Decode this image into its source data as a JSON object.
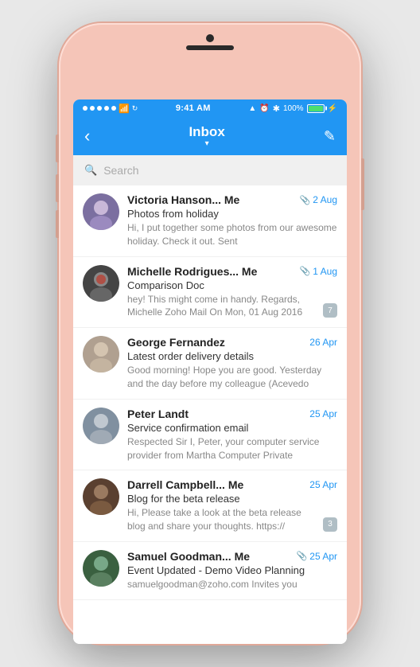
{
  "phone": {
    "status_bar": {
      "time": "9:41 AM",
      "battery_percent": "100%"
    },
    "header": {
      "back_label": "‹",
      "title": "Inbox",
      "chevron": "▾",
      "compose_label": "✎"
    },
    "search": {
      "placeholder": "Search"
    },
    "emails": [
      {
        "id": 1,
        "sender": "Victoria Hanson... Me",
        "date": "2 Aug",
        "has_attachment": true,
        "subject": "Photos from holiday",
        "preview": "Hi, I put together some photos from our awesome holiday. Check it out. Sent",
        "badge": null,
        "avatar_color": "#7B6FA0"
      },
      {
        "id": 2,
        "sender": "Michelle Rodrigues... Me",
        "date": "1 Aug",
        "has_attachment": true,
        "subject": "Comparison Doc",
        "preview": "hey! This might come in handy. Regards, Michelle Zoho Mail On Mon, 01 Aug 2016",
        "badge": "7",
        "avatar_color": "#c0392b"
      },
      {
        "id": 3,
        "sender": "George Fernandez",
        "date": "26 Apr",
        "has_attachment": false,
        "subject": "Latest order delivery details",
        "preview": "Good morning! Hope you are good. Yesterday and the day before my colleague (Acevedo",
        "badge": null,
        "avatar_color": "#95a5a6"
      },
      {
        "id": 4,
        "sender": "Peter Landt",
        "date": "25 Apr",
        "has_attachment": false,
        "subject": "Service confirmation email",
        "preview": "Respected Sir I, Peter, your computer service provider from Martha Computer Private",
        "badge": null,
        "avatar_color": "#e67e22"
      },
      {
        "id": 5,
        "sender": "Darrell Campbell... Me",
        "date": "25 Apr",
        "has_attachment": false,
        "subject": "Blog for the beta release",
        "preview": "Hi, Please take a look at the beta release blog and share your thoughts. https://",
        "badge": "3",
        "avatar_color": "#d35400"
      },
      {
        "id": 6,
        "sender": "Samuel Goodman... Me",
        "date": "25 Apr",
        "has_attachment": true,
        "subject": "Event Updated - Demo Video Planning",
        "preview": "samuelgoodman@zoho.com Invites you",
        "badge": null,
        "avatar_color": "#27ae60"
      }
    ]
  }
}
